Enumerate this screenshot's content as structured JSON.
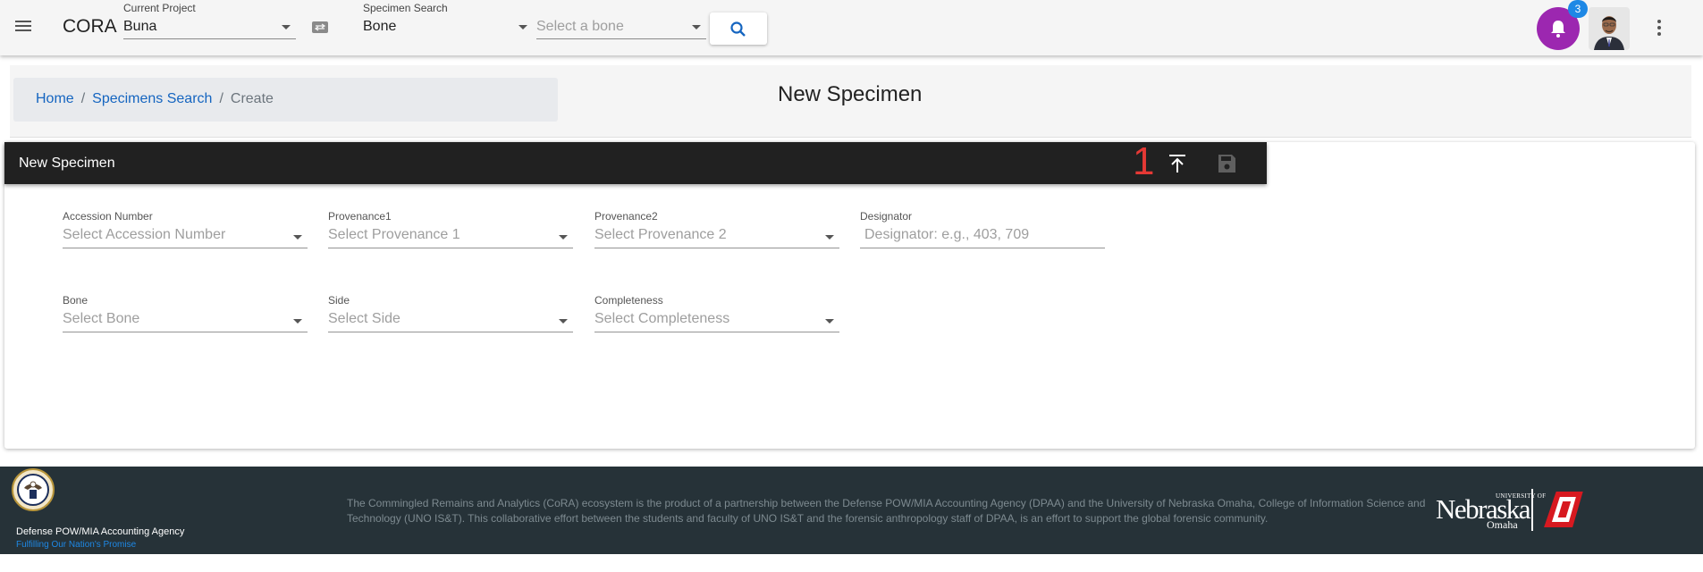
{
  "topbar": {
    "app_title": "CORA",
    "current_project_label": "Current Project",
    "current_project_value": "Buna",
    "specimen_search_label": "Specimen Search",
    "specimen_search_value": "Bone",
    "bone_select_placeholder": "Select a bone",
    "notification_count": "3",
    "icons": {
      "menu": "menu-icon",
      "swap": "swap-icon",
      "search": "search-icon",
      "bell": "bell-icon",
      "more": "more-vert-icon"
    },
    "colors": {
      "bell_bg": "#9c27b0",
      "badge_bg": "#1e88e5"
    }
  },
  "breadcrumb": {
    "home": "Home",
    "separator": "/",
    "specimens_search": "Specimens Search",
    "current": "Create"
  },
  "page_title": "New Specimen",
  "card": {
    "title": "New Specimen",
    "marker": "1",
    "icons": {
      "upload": "vertical-align-top-icon",
      "save": "save-icon"
    }
  },
  "form": {
    "accession": {
      "label": "Accession Number",
      "placeholder": "Select Accession Number"
    },
    "provenance1": {
      "label": "Provenance1",
      "placeholder": "Select Provenance 1"
    },
    "provenance2": {
      "label": "Provenance2",
      "placeholder": "Select Provenance 2"
    },
    "designator": {
      "label": "Designator",
      "placeholder": "Designator: e.g., 403, 709"
    },
    "bone": {
      "label": "Bone",
      "placeholder": "Select Bone"
    },
    "side": {
      "label": "Side",
      "placeholder": "Select Side"
    },
    "completeness": {
      "label": "Completeness",
      "placeholder": "Select Completeness"
    }
  },
  "footer": {
    "agency": "Defense POW/MIA Accounting Agency",
    "motto": "Fulfilling Our Nation's Promise",
    "disclaimer": "The Commingled Remains and Analytics (CoRA) ecosystem is the product of a partnership between the Defense POW/MIA Accounting Agency (DPAA) and the University of Nebraska Omaha, College of Information Science and Technology (UNO IS&T). This collaborative effort between the students and faculty of UNO IS&T and the forensic anthropology staff of DPAA, is an effort to support the global forensic community.",
    "unl_small": "UNIVERSITY OF",
    "unl_word": "Nebraska",
    "unl_sub": "Omaha",
    "colors": {
      "background": "#263238",
      "motto": "#1e88e5"
    }
  }
}
